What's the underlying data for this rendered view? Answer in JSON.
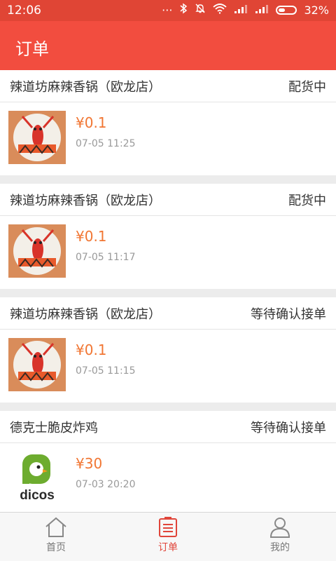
{
  "status_bar": {
    "time": "12:06",
    "battery": "32%",
    "icons": [
      "more-icon",
      "bluetooth-icon",
      "mute-icon",
      "wifi-icon",
      "signal-icon",
      "signal-icon-2",
      "battery-icon"
    ]
  },
  "app_bar": {
    "title": "订单"
  },
  "orders": [
    {
      "store": "辣道坊麻辣香锅（欧龙店）",
      "status": "配货中",
      "price": "¥0.1",
      "time": "07-05 11:25",
      "logo": "crayfish-logo"
    },
    {
      "store": "辣道坊麻辣香锅（欧龙店）",
      "status": "配货中",
      "price": "¥0.1",
      "time": "07-05 11:17",
      "logo": "crayfish-logo"
    },
    {
      "store": "辣道坊麻辣香锅（欧龙店）",
      "status": "等待确认接单",
      "price": "¥0.1",
      "time": "07-05 11:15",
      "logo": "crayfish-logo"
    },
    {
      "store": "德克士脆皮炸鸡",
      "status": "等待确认接单",
      "price": "¥30",
      "time": "07-03 20:20",
      "logo": "dicos-logo",
      "logo_text": "dicos"
    }
  ],
  "tabs": [
    {
      "label": "首页",
      "icon": "home-icon",
      "active": false
    },
    {
      "label": "订单",
      "icon": "order-icon",
      "active": true
    },
    {
      "label": "我的",
      "icon": "user-icon",
      "active": false
    }
  ],
  "colors": {
    "status_bar": "#e04535",
    "app_bar": "#f24d3f",
    "price": "#f17633",
    "active_tab": "#e0453a",
    "dicos_green": "#6dac2f"
  }
}
